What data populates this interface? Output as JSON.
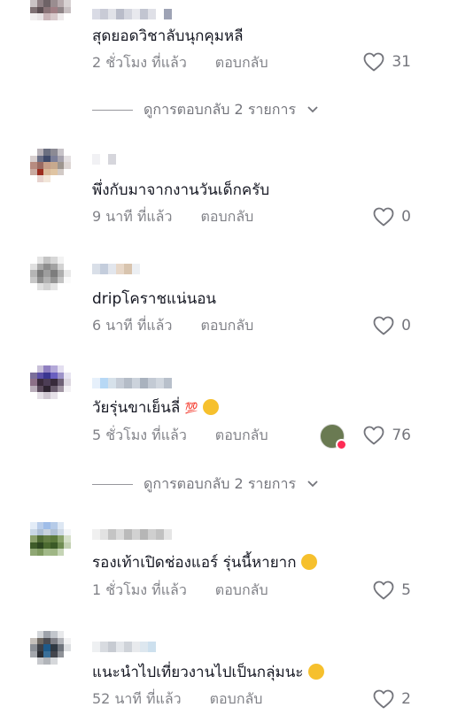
{
  "comments": [
    {
      "text": "สุดยอดวิชาลับนุกคุมหลี",
      "time": "2 ชั่วโมง ที่แล้ว",
      "reply": "ตอบกลับ",
      "likes": "31"
    },
    {
      "text": "พึ่งกับมาจากงานวันเด็กครับ",
      "time": "9 นาที ที่แล้ว",
      "reply": "ตอบกลับ",
      "likes": "0"
    },
    {
      "text": "dripโคราชแน่นอน",
      "time": "6 นาที ที่แล้ว",
      "reply": "ตอบกลับ",
      "likes": "0"
    },
    {
      "text": "วัยรุ่นขาเย็นลี่",
      "time": "5 ชั่วโมง ที่แล้ว",
      "reply": "ตอบกลับ",
      "likes": "76"
    },
    {
      "text": "รองเท้าเปิดช่องแอร์ รุ่นนี้หายาก",
      "time": "1 ชั่วโมง ที่แล้ว",
      "reply": "ตอบกลับ",
      "likes": "5"
    },
    {
      "text": "แนะนำไปเที่ยวงานไปเป็นกลุ่มนะ",
      "time": "52 นาที ที่แล้ว",
      "reply": "ตอบกลับ",
      "likes": "2"
    }
  ],
  "view_replies": [
    {
      "label": "ดูการตอบกลับ 2 รายการ"
    },
    {
      "label": "ดูการตอบกลับ 2 รายการ"
    }
  ],
  "icons": {
    "like": "heart-outline-icon",
    "expand": "chevron-down-icon",
    "creator_liked": "creator-liked-badge"
  },
  "colors": {
    "text": "#161823",
    "secondary": "#8a8b91",
    "like_badge": "#fe2c55"
  }
}
